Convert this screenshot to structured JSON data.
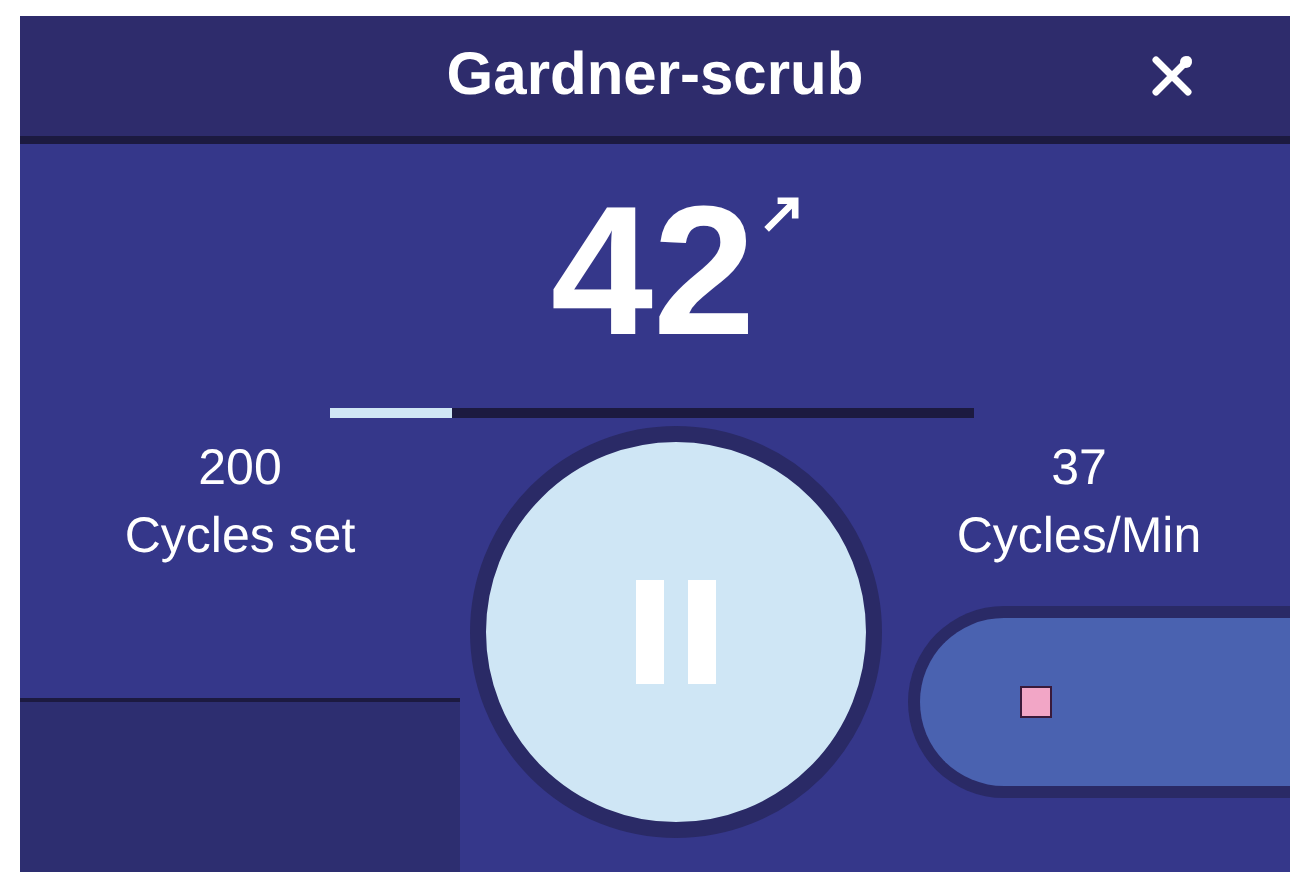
{
  "header": {
    "title": "Gardner-scrub"
  },
  "counter": {
    "value": "42",
    "progress": {
      "level": 0.19
    }
  },
  "cycles_set": {
    "value": "200",
    "label": "Cycles set"
  },
  "rate": {
    "value": "37",
    "label": "Cycles/Min"
  },
  "controls": {
    "paused": false
  }
}
